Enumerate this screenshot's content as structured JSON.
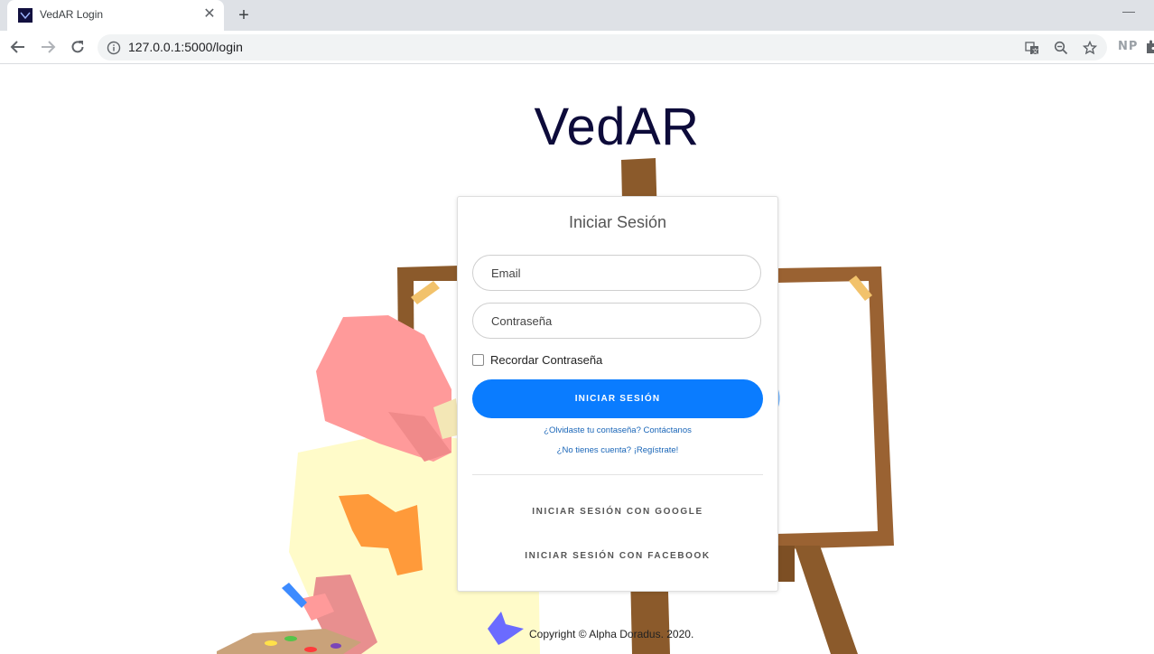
{
  "browser": {
    "tab_title": "VedAR Login",
    "tab_close": "✕",
    "new_tab": "+",
    "minimize": "—",
    "url": "127.0.0.1:5000/login",
    "extension_label": "NP"
  },
  "page": {
    "app_title": "VedAR",
    "login_card": {
      "title": "Iniciar Sesión",
      "email_placeholder": "Email",
      "password_placeholder": "Contraseña",
      "remember_label": "Recordar Contraseña",
      "remember_checked": false,
      "login_button": "INICIAR SESIÓN",
      "forgot_link": "¿Olvidaste tu contaseña? Contáctanos",
      "register_link": "¿No tienes cuenta? ¡Regístrate!",
      "google_button": "INICIAR SESIÓN CON GOOGLE",
      "facebook_button": "INICIAR SESIÓN CON FACEBOOK"
    },
    "copyright": "Copyright © Alpha Doradus. 2020."
  },
  "colors": {
    "primary": "#0a7cff",
    "title": "#0d0b3a",
    "easel": "#8b5a2b"
  }
}
